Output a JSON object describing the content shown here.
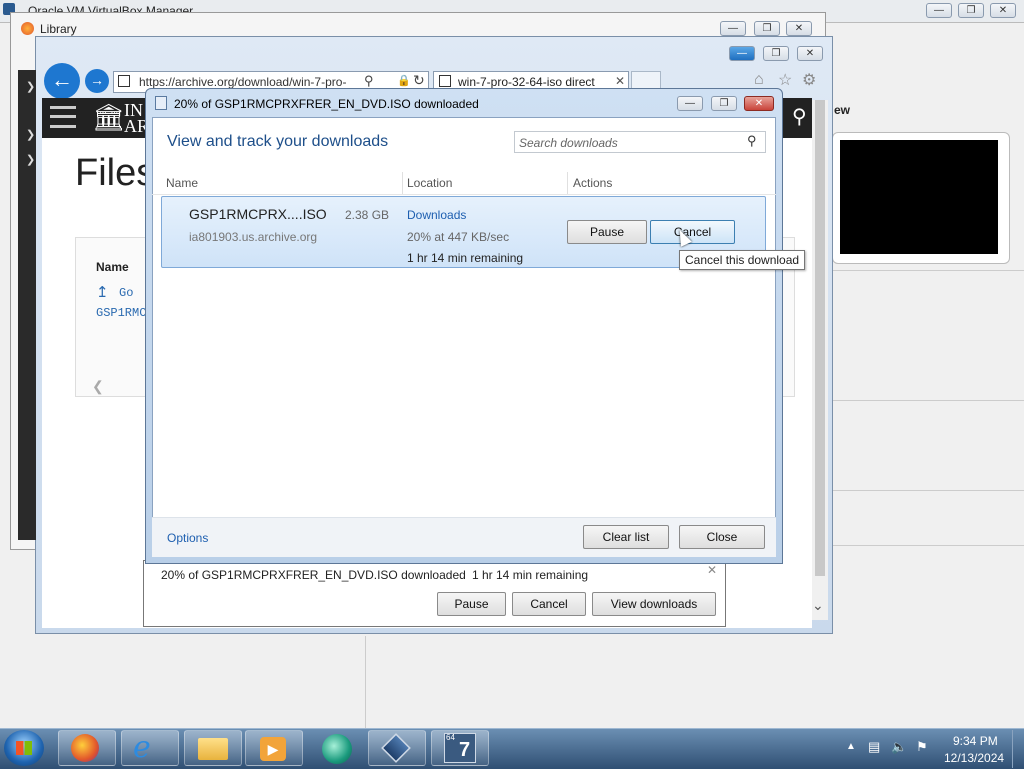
{
  "desktop": {
    "vbox_title": "Oracle VM VirtualBox Manager",
    "preview_label": "ew"
  },
  "firefox": {
    "title": "Library"
  },
  "ie": {
    "url": "https://archive.org/download/win-7-pro-",
    "tab_title": "win-7-pro-32-64-iso direct",
    "page_heading": "Files",
    "site_logo_text_1": "IN",
    "site_logo_text_2": "AR",
    "table_head": "Name",
    "row_parent": "Go",
    "row_file": "GSP1RMC"
  },
  "dialog": {
    "title": "20% of GSP1RMCPRXFRER_EN_DVD.ISO downloaded",
    "heading": "View and track your downloads",
    "search_placeholder": "Search downloads",
    "columns": {
      "name": "Name",
      "location": "Location",
      "actions": "Actions"
    },
    "item": {
      "filename": "GSP1RMCPRX....ISO",
      "size": "2.38 GB",
      "source": "ia801903.us.archive.org",
      "location": "Downloads",
      "progress_text": "20% at 447 KB/sec",
      "remaining": "1 hr 14 min remaining"
    },
    "pause_label": "Pause",
    "cancel_label": "Cancel",
    "tooltip": "Cancel this download",
    "options_link": "Options",
    "clear_label": "Clear list",
    "close_label": "Close"
  },
  "notification": {
    "text": "20% of GSP1RMCPRXFRER_EN_DVD.ISO downloaded",
    "remaining": "1 hr 14 min remaining",
    "pause_label": "Pause",
    "cancel_label": "Cancel",
    "view_label": "View downloads"
  },
  "taskbar": {
    "time": "9:34 PM",
    "date": "12/13/2024",
    "app7_label": "64",
    "app7_digit": "7"
  }
}
